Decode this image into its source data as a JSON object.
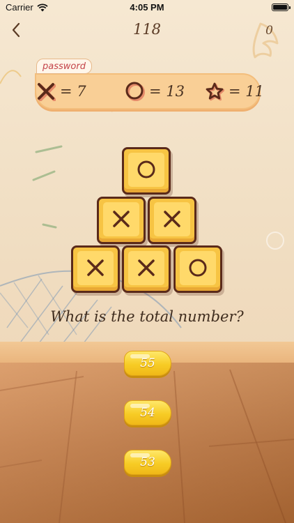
{
  "status_bar": {
    "carrier": "Carrier",
    "time": "4:05 PM"
  },
  "header": {
    "level": "118",
    "score": "0"
  },
  "password_panel": {
    "tag_label": "password",
    "items": [
      {
        "icon": "cross-icon",
        "text": "= 7"
      },
      {
        "icon": "circle-icon",
        "text": "= 13"
      },
      {
        "icon": "star-icon",
        "text": "= 11"
      }
    ]
  },
  "pyramid": {
    "rows": [
      [
        "circle"
      ],
      [
        "cross",
        "cross"
      ],
      [
        "cross",
        "cross",
        "circle"
      ]
    ]
  },
  "question": "What is the total number?",
  "answers": [
    "55",
    "54",
    "53"
  ],
  "colors": {
    "block_fill": "#f7c443",
    "block_border": "#5a2a1a",
    "answer_button": "#f7cc25",
    "password_tag_text": "#c4444a"
  }
}
